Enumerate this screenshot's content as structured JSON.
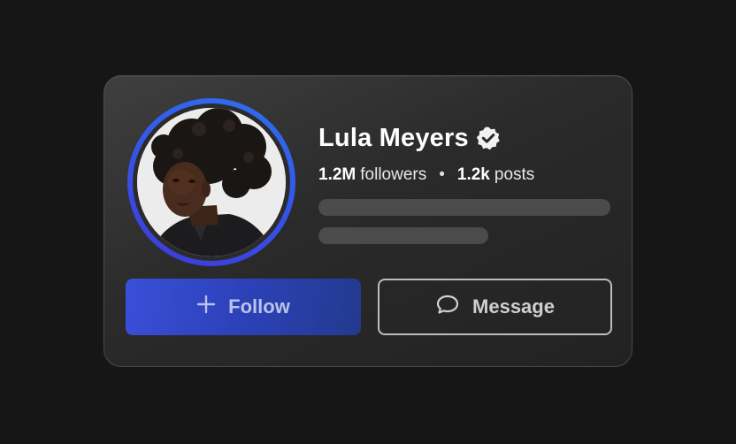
{
  "profile": {
    "name": "Lula Meyers",
    "verified": true,
    "followers_count": "1.2M",
    "followers_label": "followers",
    "separator": "•",
    "posts_count": "1.2k",
    "posts_label": "posts"
  },
  "actions": {
    "follow_label": "Follow",
    "message_label": "Message"
  },
  "icons": {
    "verified": "verified-badge-icon",
    "follow": "plus-icon",
    "message": "chat-bubble-icon"
  },
  "colors": {
    "page_background": "#161616",
    "card_background": "#2a2a2a",
    "avatar_ring": "#3552e6",
    "follow_button": "#2c41b8",
    "message_border": "#bdbdbd",
    "placeholder_bar": "#4b4b4b"
  }
}
